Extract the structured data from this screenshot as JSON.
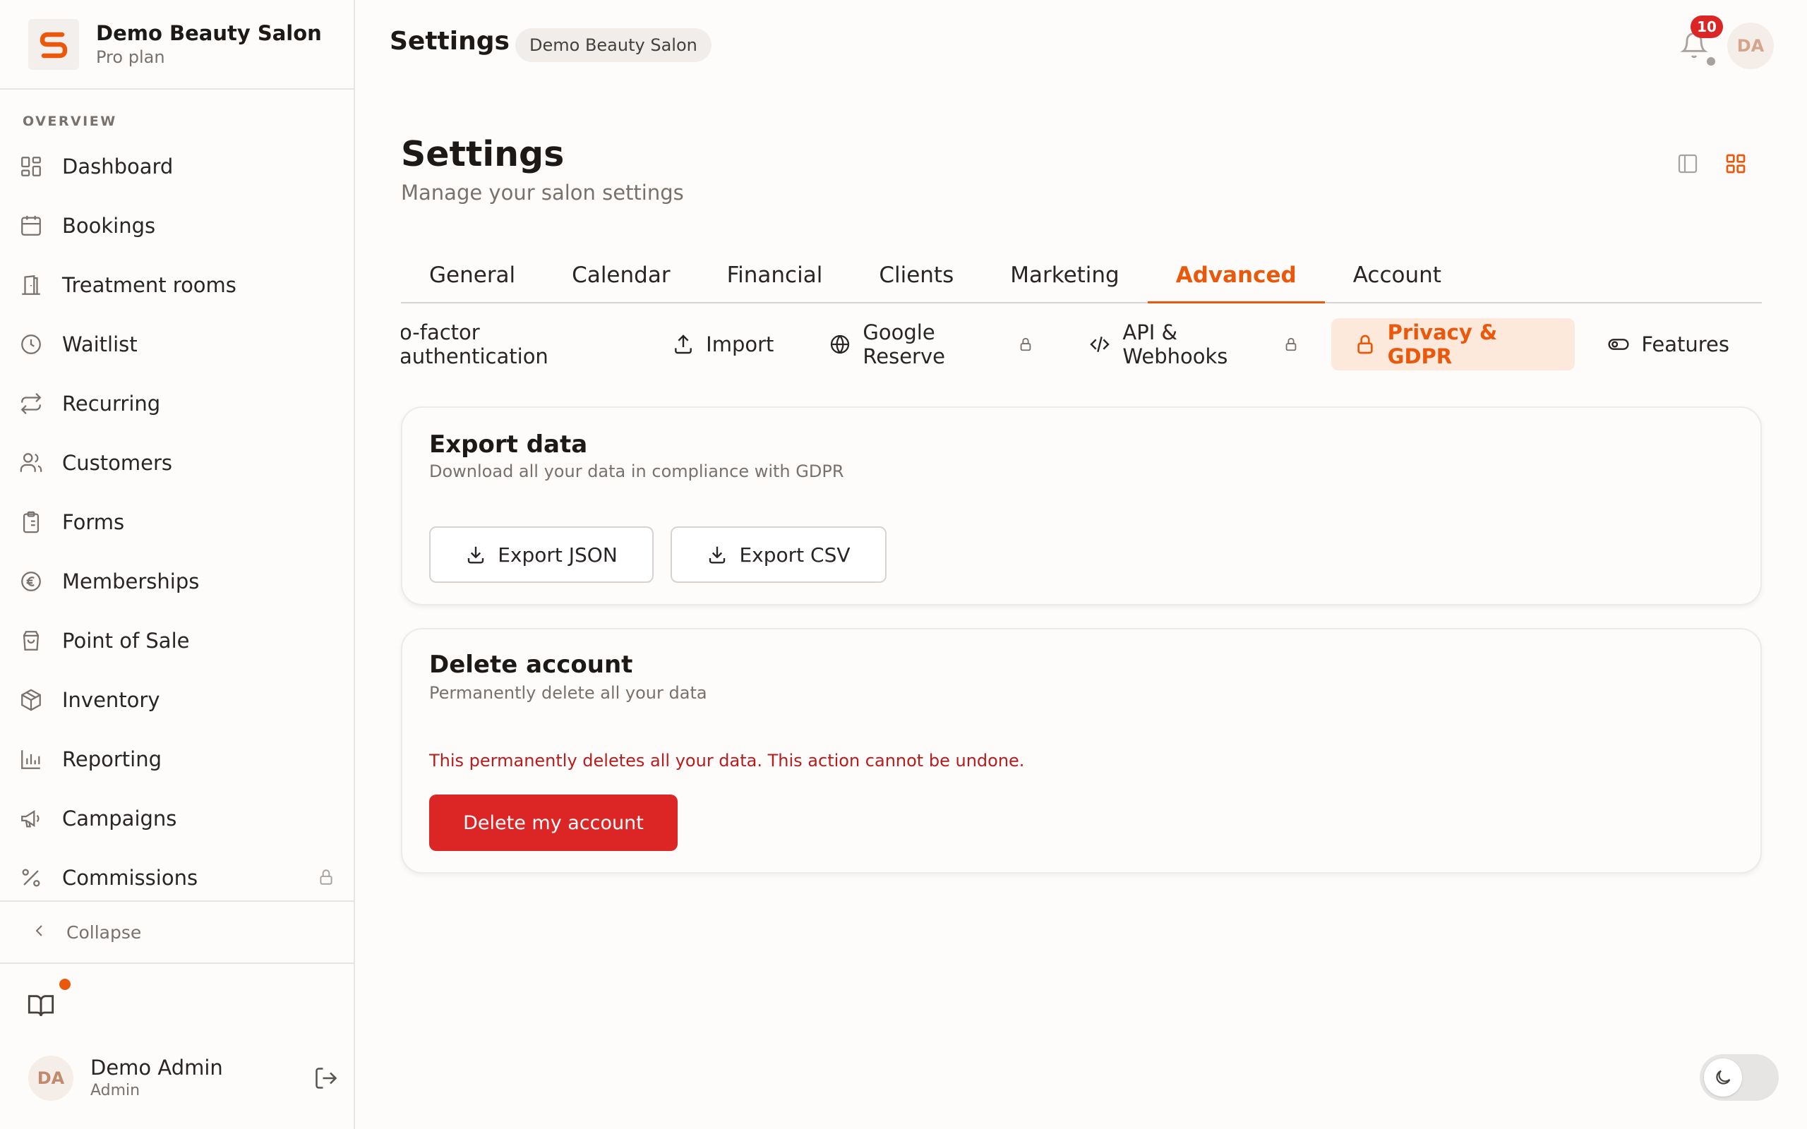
{
  "brand": {
    "name": "Demo Beauty Salon",
    "plan": "Pro plan",
    "logo_letter": "S"
  },
  "sidebar": {
    "section_label": "OVERVIEW",
    "items": [
      {
        "label": "Dashboard",
        "icon": "dashboard-icon"
      },
      {
        "label": "Bookings",
        "icon": "calendar-icon"
      },
      {
        "label": "Treatment rooms",
        "icon": "door-icon"
      },
      {
        "label": "Waitlist",
        "icon": "clock-icon"
      },
      {
        "label": "Recurring",
        "icon": "repeat-icon"
      },
      {
        "label": "Customers",
        "icon": "users-icon"
      },
      {
        "label": "Forms",
        "icon": "clipboard-icon"
      },
      {
        "label": "Memberships",
        "icon": "euro-icon"
      },
      {
        "label": "Point of Sale",
        "icon": "shopping-bag-icon"
      },
      {
        "label": "Inventory",
        "icon": "package-icon"
      },
      {
        "label": "Reporting",
        "icon": "bar-chart-icon"
      },
      {
        "label": "Campaigns",
        "icon": "megaphone-icon"
      },
      {
        "label": "Commissions",
        "icon": "percent-icon",
        "locked": true
      }
    ],
    "collapse_label": "Collapse"
  },
  "user": {
    "name": "Demo Admin",
    "role": "Admin",
    "initials": "DA"
  },
  "topbar": {
    "title": "Settings",
    "salon_chip": "Demo Beauty Salon",
    "notification_count": "10",
    "avatar_initials": "DA"
  },
  "page": {
    "title": "Settings",
    "subtitle": "Manage your salon settings"
  },
  "tabs": [
    "General",
    "Calendar",
    "Financial",
    "Clients",
    "Marketing",
    "Advanced",
    "Account"
  ],
  "active_tab": "Advanced",
  "subtabs": [
    {
      "label": "Two-factor authentication",
      "visible_text": "o-factor authentication"
    },
    {
      "label": "Import",
      "icon": "upload-icon"
    },
    {
      "label": "Google Reserve",
      "icon": "globe-icon",
      "locked": true
    },
    {
      "label": "API & Webhooks",
      "icon": "code-icon",
      "locked": true
    },
    {
      "label": "Privacy & GDPR",
      "icon": "lock-icon",
      "active": true
    },
    {
      "label": "Features",
      "icon": "toggle-icon"
    }
  ],
  "export_card": {
    "title": "Export data",
    "description": "Download all your data in compliance with GDPR",
    "json_button": "Export JSON",
    "csv_button": "Export CSV"
  },
  "delete_card": {
    "title": "Delete account",
    "description": "Permanently delete all your data",
    "warning": "This permanently deletes all your data. This action cannot be undone.",
    "delete_button": "Delete my account"
  },
  "colors": {
    "accent": "#ea580c",
    "danger": "#dc2626",
    "active_subtab_bg": "#fde8dc"
  }
}
